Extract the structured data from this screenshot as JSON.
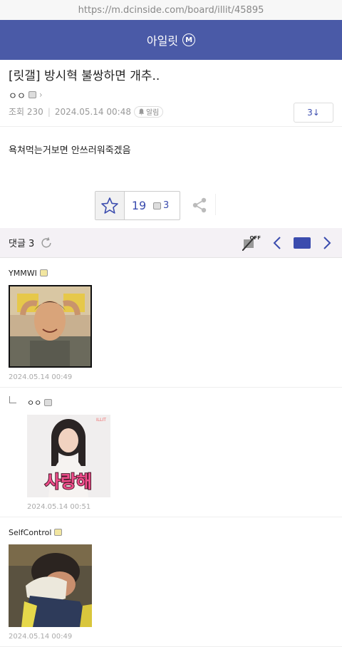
{
  "browser": {
    "url": "https://m.dcinside.com/board/illit/45895"
  },
  "gallery": {
    "name": "아일릿",
    "badge": "M"
  },
  "post": {
    "title": "[릿갤] 방시혁 불쌍하면 개추..",
    "writer": "ㅇㅇ",
    "views": "조회 230",
    "date": "2024.05.14 00:48",
    "alarm": "알림",
    "reply_btn": "3↓",
    "body": "욕쳐먹는거보면 안쓰러워죽겠음"
  },
  "reco": {
    "count": "19",
    "comments": "3"
  },
  "comment_bar": {
    "label": "댓글 3",
    "img_off": "OFF"
  },
  "comments": [
    {
      "name": "YMMWI",
      "date": "2024.05.14 00:49"
    },
    {
      "name": "ㅇㅇ",
      "date": "2024.05.14 00:51",
      "image_text": "사랑해",
      "image_tag": "ILLIT"
    },
    {
      "name": "SelfControl",
      "date": "2024.05.14 00:49"
    }
  ],
  "colors": {
    "brand": "#4a5aa7",
    "accent": "#3b4cae"
  }
}
